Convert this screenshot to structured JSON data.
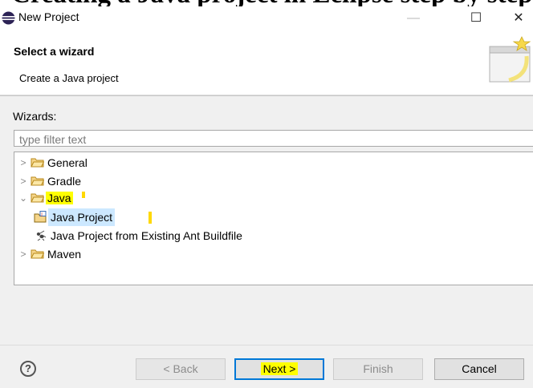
{
  "header_overlay": {
    "partial_text": "Creating a Java project in Eclipse step by step"
  },
  "window": {
    "title": "New Project",
    "minimize_glyph": "—",
    "maximize_glyph": "☐",
    "close_glyph": "✕"
  },
  "header": {
    "title": "Select a wizard",
    "subtitle": "Create a Java project",
    "banner_icon": "wizard-banner-icon"
  },
  "wizards": {
    "label": "Wizards:",
    "filter_placeholder": "type filter text",
    "tree": [
      {
        "label": "General",
        "expanded": false,
        "icon": "folder-icon"
      },
      {
        "label": "Gradle",
        "expanded": false,
        "icon": "folder-icon"
      },
      {
        "label": "Java",
        "expanded": true,
        "highlighted": true,
        "icon": "folder-icon",
        "children": [
          {
            "label": "Java Project",
            "selected": true,
            "icon": "java-project-icon"
          },
          {
            "label": "Java Project from Existing Ant Buildfile",
            "icon": "ant-icon"
          }
        ]
      },
      {
        "label": "Maven",
        "expanded": false,
        "icon": "folder-icon"
      }
    ]
  },
  "footer": {
    "help_glyph": "?",
    "back_label": "< Back",
    "next_label": "Next >",
    "finish_label": "Finish",
    "cancel_label": "Cancel"
  },
  "colors": {
    "highlight": "#ffff00",
    "selection": "#cce8ff",
    "focus_border": "#0078d7",
    "folder": "#e8b13a"
  }
}
